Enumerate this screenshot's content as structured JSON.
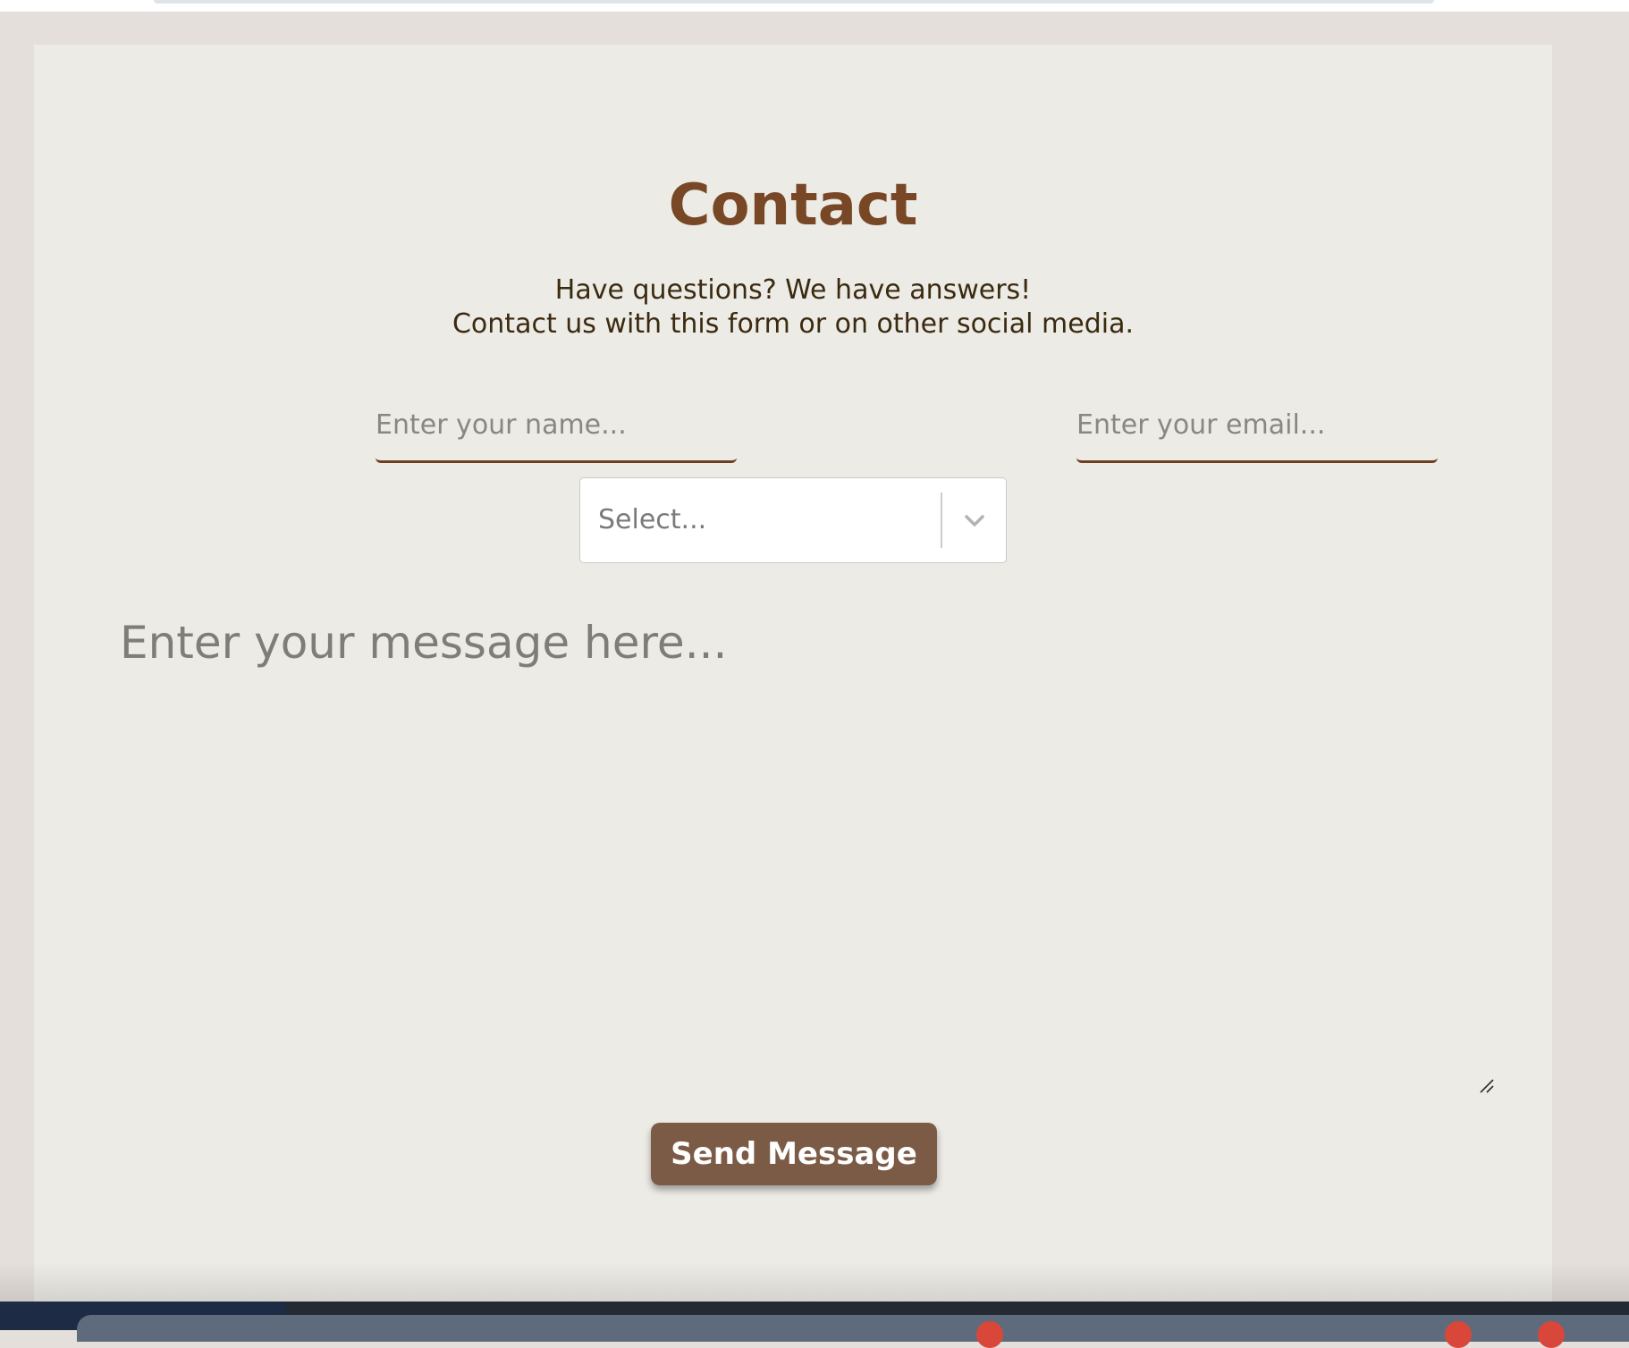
{
  "contact": {
    "title": "Contact",
    "subtitle_line1": "Have questions? We have answers!",
    "subtitle_line2": "Contact us with this form or on other social media.",
    "name_placeholder": "Enter your name...",
    "email_placeholder": "Enter your email...",
    "select_value": "Select...",
    "message_placeholder": "Enter your message here...",
    "send_label": "Send Message"
  },
  "icons": {
    "select_arrow": "chevron-down-icon",
    "textarea_resize": "resize-handle-icon"
  },
  "colors": {
    "page_background": "#e4dfda",
    "card_background": "#edebe6",
    "title": "#784726",
    "body_text": "#3a2a10",
    "input_underline": "#6f3e1f",
    "button_background": "#7b5a46",
    "button_text": "#ffffff"
  }
}
